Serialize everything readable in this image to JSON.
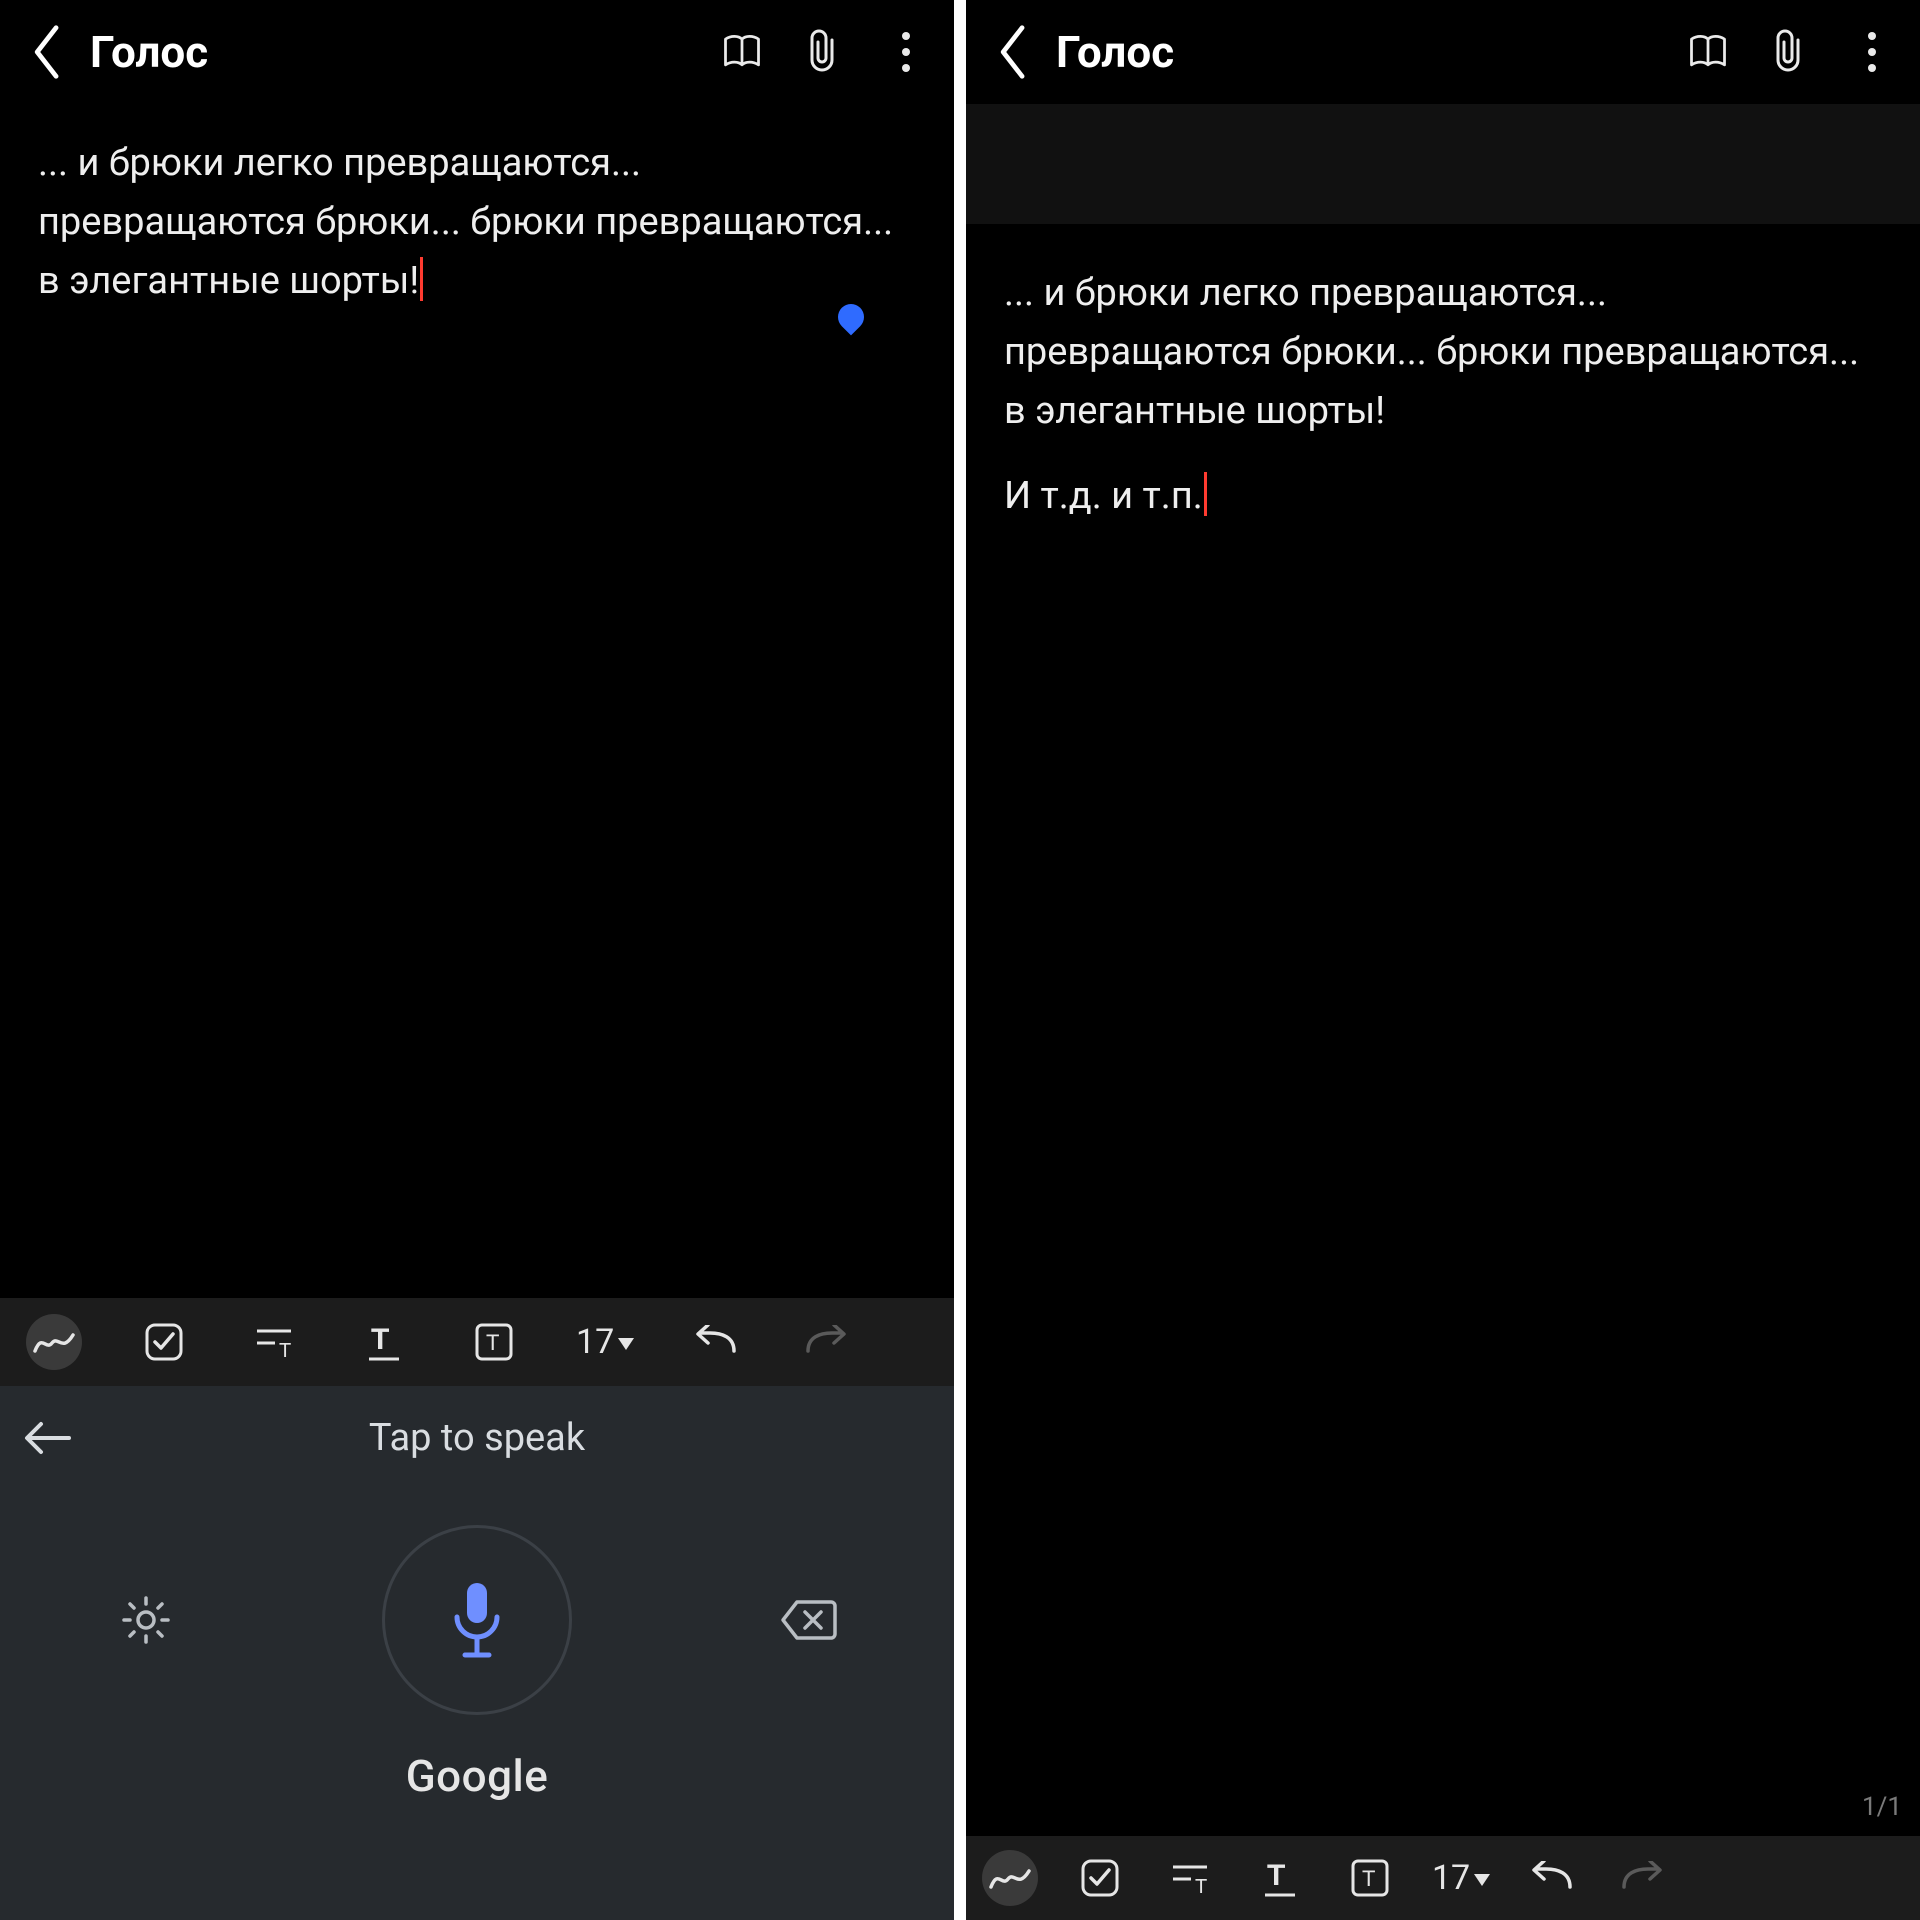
{
  "left": {
    "header": {
      "title": "Голос"
    },
    "note": {
      "paragraphs": [
        "... и брюки легко превращаются... превращаются брюки... брюки превращаются... в элегантные шорты!"
      ]
    },
    "toolbar": {
      "font_size": "17"
    },
    "voice": {
      "prompt": "Tap to speak",
      "brand": "Google"
    }
  },
  "right": {
    "header": {
      "title": "Голос"
    },
    "note": {
      "paragraphs": [
        "... и брюки легко превращаются... превращаются брюки... брюки превращаются... в элегантные шорты!",
        "И т.д. и т.п."
      ]
    },
    "toolbar": {
      "font_size": "17"
    },
    "page_indicator": "1/1"
  }
}
